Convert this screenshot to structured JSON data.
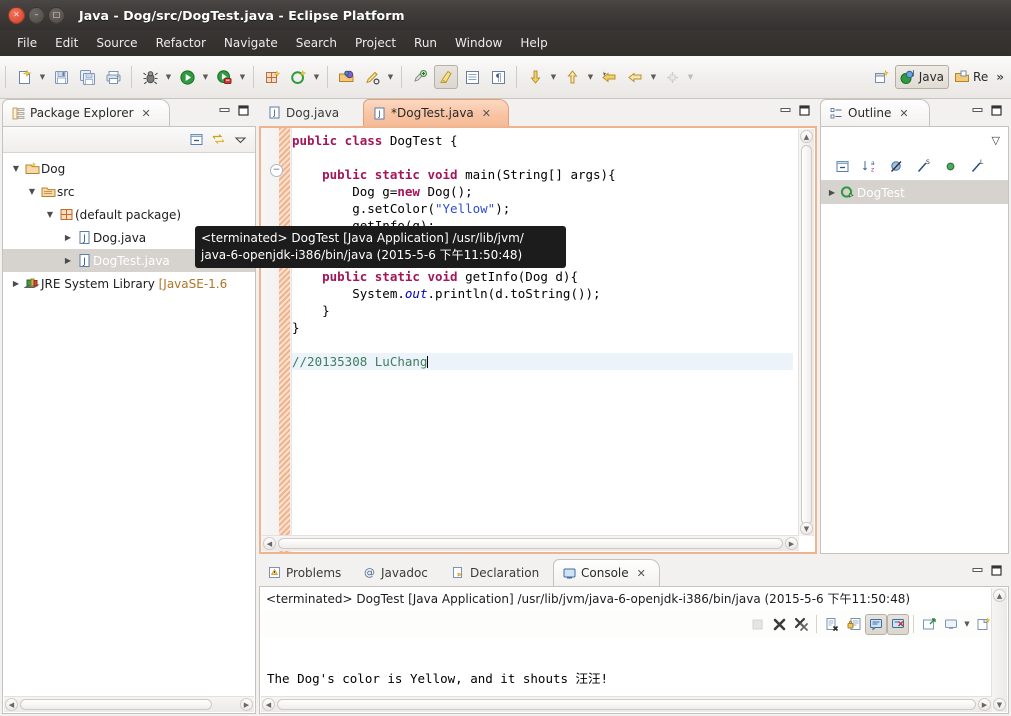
{
  "window": {
    "title": "Java - Dog/src/DogTest.java - Eclipse Platform",
    "close_glyph": "✕",
    "min_glyph": "–",
    "max_glyph": "□"
  },
  "menubar": {
    "items": [
      "File",
      "Edit",
      "Source",
      "Refactor",
      "Navigate",
      "Search",
      "Project",
      "Run",
      "Window",
      "Help"
    ]
  },
  "toolbar": {
    "groups": [
      {
        "buttons": [
          {
            "name": "new-wizard-button",
            "icon": "new-file-icon",
            "arrow": true
          },
          {
            "name": "save-button",
            "icon": "save-icon",
            "arrow": false
          },
          {
            "name": "save-all-button",
            "icon": "save-all-icon",
            "arrow": false
          },
          {
            "name": "print-button",
            "icon": "print-icon",
            "arrow": false
          }
        ]
      },
      {
        "buttons": [
          {
            "name": "debug-button",
            "icon": "debug-bug-icon",
            "arrow": true
          },
          {
            "name": "run-button",
            "icon": "run-play-icon",
            "arrow": true
          },
          {
            "name": "external-tools-button",
            "icon": "external-tools-icon",
            "arrow": true
          }
        ]
      },
      {
        "buttons": [
          {
            "name": "new-java-project-button",
            "icon": "java-project-icon",
            "arrow": false
          },
          {
            "name": "new-java-class-button",
            "icon": "new-class-icon",
            "arrow": true
          }
        ]
      },
      {
        "buttons": [
          {
            "name": "open-type-button",
            "icon": "open-type-icon",
            "arrow": false
          },
          {
            "name": "search-button",
            "icon": "search-pencil-icon",
            "arrow": true
          }
        ]
      },
      {
        "buttons": [
          {
            "name": "last-edit-location-button",
            "icon": "last-edit-icon",
            "arrow": false
          },
          {
            "name": "toggle-mark-occurrences-button",
            "icon": "highlighter-icon",
            "arrow": false,
            "pressed": true
          },
          {
            "name": "toggle-block-selection-button",
            "icon": "block-selection-icon",
            "arrow": false
          },
          {
            "name": "show-whitespace-button",
            "icon": "pilcrow-icon",
            "arrow": false
          }
        ]
      },
      {
        "buttons": [
          {
            "name": "next-annotation-button",
            "icon": "arrow-down-yellow-icon",
            "arrow": true
          },
          {
            "name": "previous-annotation-button",
            "icon": "arrow-up-yellow-icon",
            "arrow": true
          },
          {
            "name": "back-history-button",
            "icon": "back-arrow-icon",
            "arrow": false
          },
          {
            "name": "forward-history-button",
            "icon": "forward-arrow-icon",
            "arrow": true
          },
          {
            "name": "pin-editor-button",
            "icon": "pin-icon",
            "arrow": true,
            "disabled": true
          }
        ]
      }
    ],
    "perspective": {
      "open_perspective_name": "open-perspective-icon",
      "items": [
        {
          "name": "perspective-java",
          "label": "Java",
          "icon": "java-perspective-icon",
          "active": true
        },
        {
          "name": "perspective-resource",
          "label": "Re",
          "icon": "resource-perspective-icon",
          "active": false
        }
      ],
      "overflow_glyph": "»"
    }
  },
  "package_explorer": {
    "tab_label": "Package Explorer",
    "tab_icon": "package-explorer-icon",
    "close_glyph": "✕",
    "minimize_glyph": "−",
    "maximize_glyph": "□",
    "toolbar": [
      {
        "name": "collapse-all-button",
        "icon": "collapse-all-icon"
      },
      {
        "name": "link-with-editor-button",
        "icon": "link-editor-icon"
      },
      {
        "name": "view-menu-button",
        "icon": "view-menu-chevron-icon"
      }
    ],
    "tree": [
      {
        "label": "Dog",
        "icon": "java-project-folder-icon",
        "indent": 0,
        "expanded": true,
        "selected": false
      },
      {
        "label": "src",
        "icon": "source-folder-icon",
        "indent": 1,
        "expanded": true,
        "selected": false
      },
      {
        "label": "(default package)",
        "icon": "package-icon",
        "indent": 2,
        "expanded": true,
        "selected": false
      },
      {
        "label": "Dog.java",
        "icon": "java-file-icon",
        "indent": 3,
        "expanded": false,
        "selected": false
      },
      {
        "label": "DogTest.java",
        "icon": "java-file-icon",
        "indent": 3,
        "expanded": false,
        "selected": true
      },
      {
        "label": "JRE System Library ",
        "suffix": "[JavaSE-1.6",
        "icon": "jre-library-icon",
        "indent": 0,
        "expanded": false,
        "selected": false
      }
    ]
  },
  "editor": {
    "tabs": [
      {
        "name": "tab-dog-java",
        "label": "Dog.java",
        "icon": "java-file-icon",
        "active": false,
        "dirty": false
      },
      {
        "name": "tab-dogtest-java",
        "label": "*DogTest.java",
        "icon": "java-file-icon",
        "active": true,
        "dirty": true,
        "close_glyph": "✕"
      }
    ],
    "minimize_glyph": "−",
    "maximize_glyph": "□",
    "code_lines": [
      {
        "segments": [
          {
            "t": "public class ",
            "c": "kw"
          },
          {
            "t": "DogTest {",
            "c": ""
          }
        ],
        "indent": 0
      },
      {
        "segments": [
          {
            "t": "",
            "c": ""
          }
        ],
        "indent": 0
      },
      {
        "segments": [
          {
            "t": "    public static void ",
            "c": "kw"
          },
          {
            "t": "main(String[] args){",
            "c": ""
          }
        ],
        "indent": 0,
        "fold": true
      },
      {
        "segments": [
          {
            "t": "        Dog g=",
            "c": ""
          },
          {
            "t": "new",
            "c": "kw"
          },
          {
            "t": " Dog();",
            "c": ""
          }
        ],
        "indent": 0
      },
      {
        "segments": [
          {
            "t": "        g.setColor(",
            "c": ""
          },
          {
            "t": "\"Yellow\"",
            "c": "str"
          },
          {
            "t": ");",
            "c": ""
          }
        ],
        "indent": 0
      },
      {
        "segments": [
          {
            "t": "        getInfo(g);",
            "c": ""
          }
        ],
        "indent": 0
      },
      {
        "segments": [
          {
            "t": "    }",
            "c": ""
          }
        ],
        "indent": 0
      },
      {
        "segments": [
          {
            "t": "",
            "c": ""
          }
        ],
        "indent": 0
      },
      {
        "segments": [
          {
            "t": "    public static void ",
            "c": "kw"
          },
          {
            "t": "getInfo(Dog d){",
            "c": ""
          }
        ],
        "indent": 0
      },
      {
        "segments": [
          {
            "t": "        System.",
            "c": ""
          },
          {
            "t": "out",
            "c": "fld"
          },
          {
            "t": ".println(d.toString());",
            "c": ""
          }
        ],
        "indent": 0
      },
      {
        "segments": [
          {
            "t": "    }",
            "c": ""
          }
        ],
        "indent": 0
      },
      {
        "segments": [
          {
            "t": "}",
            "c": ""
          }
        ],
        "indent": 0
      },
      {
        "segments": [
          {
            "t": "",
            "c": ""
          }
        ],
        "indent": 0
      },
      {
        "segments": [
          {
            "t": "//20135308 LuChang",
            "c": "cmt"
          }
        ],
        "indent": 0,
        "caret": true
      }
    ]
  },
  "tooltip": {
    "line1": "<terminated> DogTest [Java Application] /usr/lib/jvm/",
    "line2": "java-6-openjdk-i386/bin/java (2015-5-6 下午11:50:48)"
  },
  "outline": {
    "tab_label": "Outline",
    "tab_icon": "outline-icon",
    "close_glyph": "✕",
    "minimize_glyph": "−",
    "maximize_glyph": "□",
    "menu_glyph": "▽",
    "toolbar": [
      {
        "name": "collapse-all-button",
        "icon": "collapse-all-icon"
      },
      {
        "name": "sort-button",
        "icon": "sort-az-icon"
      },
      {
        "name": "hide-fields-button",
        "icon": "hide-fields-icon"
      },
      {
        "name": "hide-static-button",
        "icon": "hide-static-icon"
      },
      {
        "name": "hide-nonpublic-button",
        "icon": "hide-nonpublic-icon"
      },
      {
        "name": "hide-local-types-button",
        "icon": "hide-local-types-icon"
      }
    ],
    "items": [
      {
        "label": "DogTest",
        "icon": "class-icon",
        "selected": true,
        "expandable": true
      }
    ]
  },
  "bottom_panel": {
    "tabs": [
      {
        "name": "tab-problems",
        "label": "Problems",
        "icon": "problems-icon",
        "active": false
      },
      {
        "name": "tab-javadoc",
        "label": "Javadoc",
        "icon": "javadoc-at-icon",
        "active": false
      },
      {
        "name": "tab-declaration",
        "label": "Declaration",
        "icon": "declaration-icon",
        "active": false
      },
      {
        "name": "tab-console",
        "label": "Console",
        "icon": "console-icon",
        "active": true,
        "close_glyph": "✕"
      }
    ],
    "minimize_glyph": "−",
    "maximize_glyph": "□",
    "launch_line": "<terminated> DogTest [Java Application] /usr/lib/jvm/java-6-openjdk-i386/bin/java (2015-5-6 下午11:50:48)",
    "toolbar": [
      {
        "name": "terminate-all-button",
        "icon": "terminate-grey-icon",
        "disabled": true
      },
      {
        "name": "terminate-button",
        "icon": "terminate-x-icon"
      },
      {
        "name": "remove-all-terminated-button",
        "icon": "remove-all-terminated-icon"
      },
      {
        "name": "clear-console-button",
        "icon": "clear-console-icon"
      },
      {
        "name": "scroll-lock-button",
        "icon": "scroll-lock-icon"
      },
      {
        "name": "show-console-on-output-button",
        "icon": "show-console-output-icon",
        "toggled": true
      },
      {
        "name": "show-console-on-error-button",
        "icon": "show-console-error-icon",
        "toggled": true
      },
      {
        "name": "pin-console-button",
        "icon": "pin-console-icon"
      },
      {
        "name": "display-selected-console-button",
        "icon": "display-console-icon",
        "arrow": true
      },
      {
        "name": "open-console-button",
        "icon": "open-console-icon",
        "arrow": true
      }
    ],
    "output": "The Dog's color is Yellow, and it shouts 汪汪!"
  },
  "colors": {
    "titlebar": "#3c3835",
    "accent_tab": "#f6bb97",
    "editor_border": "#f0b48c",
    "selection": "#d6d2ce",
    "keyword": "#a4145a",
    "string": "#2a4fd6",
    "comment": "#3f7f5f",
    "field": "#0000c0",
    "link_text": "#b0742a"
  }
}
